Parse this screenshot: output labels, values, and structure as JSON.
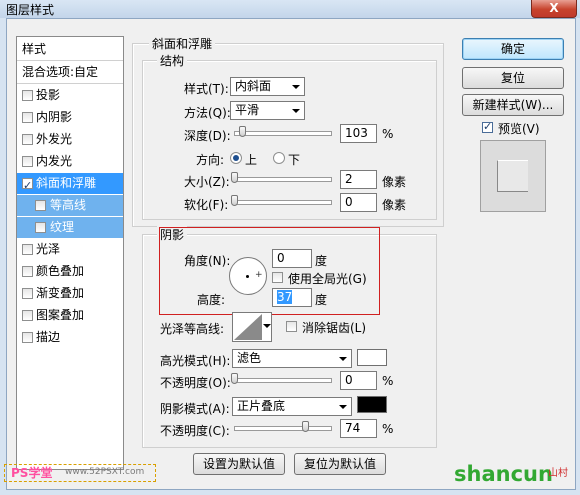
{
  "window": {
    "title": "图层样式",
    "close_label": "X"
  },
  "style_list": {
    "header": "样式",
    "blend_options": "混合选项:自定",
    "items": [
      {
        "label": "投影",
        "checked": false
      },
      {
        "label": "内阴影",
        "checked": false
      },
      {
        "label": "外发光",
        "checked": false
      },
      {
        "label": "内发光",
        "checked": false
      },
      {
        "label": "斜面和浮雕",
        "checked": true,
        "selected": true
      },
      {
        "label": "等高线",
        "checked": false,
        "sub": true
      },
      {
        "label": "纹理",
        "checked": false,
        "sub": true
      },
      {
        "label": "光泽",
        "checked": false
      },
      {
        "label": "颜色叠加",
        "checked": false
      },
      {
        "label": "渐变叠加",
        "checked": false
      },
      {
        "label": "图案叠加",
        "checked": false
      },
      {
        "label": "描边",
        "checked": false
      }
    ]
  },
  "bevel": {
    "group_title": "斜面和浮雕",
    "structure": {
      "title": "结构",
      "style_label": "样式(T):",
      "style_value": "内斜面",
      "method_label": "方法(Q):",
      "method_value": "平滑",
      "depth_label": "深度(D):",
      "depth_value": "103",
      "depth_unit": "%",
      "depth_pct": 0.1,
      "direction_label": "方向:",
      "dir_up": "上",
      "dir_down": "下",
      "size_label": "大小(Z):",
      "size_value": "2",
      "size_unit": "像素",
      "soften_label": "软化(F):",
      "soften_value": "0",
      "soften_unit": "像素"
    },
    "shading": {
      "title": "阴影",
      "angle_label": "角度(N):",
      "angle_value": "0",
      "angle_unit": "度",
      "global_light_label": "使用全局光(G)",
      "altitude_label": "高度:",
      "altitude_value": "37",
      "altitude_unit": "度",
      "gloss_label": "光泽等高线:",
      "antialias_label": "消除锯齿(L)",
      "highlight_mode_label": "高光模式(H):",
      "highlight_mode_value": "滤色",
      "highlight_color": "#ffffff",
      "opacity1_label": "不透明度(O):",
      "opacity1_value": "0",
      "opacity1_unit": "%",
      "shadow_mode_label": "阴影模式(A):",
      "shadow_mode_value": "正片叠底",
      "shadow_color": "#000000",
      "opacity2_label": "不透明度(C):",
      "opacity2_value": "74",
      "opacity2_unit": "%"
    },
    "make_default": "设置为默认值",
    "reset_default": "复位为默认值"
  },
  "actions": {
    "ok": "确定",
    "reset": "复位",
    "new_style": "新建样式(W)...",
    "preview": "预览(V)"
  },
  "watermarks": {
    "left": "PS学堂",
    "left_url": "www.52PSXT.com",
    "right": "shancun",
    "right_sub": "山村"
  }
}
